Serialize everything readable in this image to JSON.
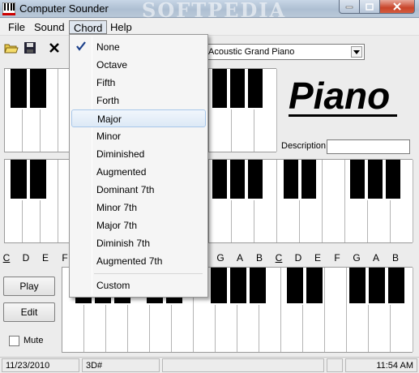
{
  "window": {
    "title": "Computer Sounder",
    "watermark": "SOFTPEDIA",
    "watermark2": "SOFTPEDIA"
  },
  "menubar": {
    "items": [
      {
        "label": "File"
      },
      {
        "label": "Sound"
      },
      {
        "label": "Chord"
      },
      {
        "label": "Help"
      }
    ],
    "active": "Chord"
  },
  "toolbar": {
    "buttons": [
      "open-folder-icon",
      "save-disk-icon",
      "close-x-icon"
    ]
  },
  "instrument": {
    "selected": "Acoustic Grand Piano"
  },
  "instrument_title": "Piano",
  "description": {
    "label": "Description:",
    "value": ""
  },
  "note_labels": [
    "C",
    "D",
    "E",
    "F",
    "G",
    "A",
    "B",
    "C",
    "D",
    "E",
    "F",
    "G",
    "A",
    "B"
  ],
  "buttons": {
    "play": "Play",
    "edit": "Edit"
  },
  "mute": {
    "label": "Mute",
    "checked": false
  },
  "status": {
    "date": "11/23/2010",
    "key": "3D#",
    "blank1": "",
    "blank2": "",
    "time": "11:54 AM"
  },
  "chord_menu": {
    "items": [
      {
        "label": "None",
        "checked": true
      },
      {
        "label": "Octave",
        "checked": false
      },
      {
        "label": "Fifth",
        "checked": false
      },
      {
        "label": "Forth",
        "checked": false
      },
      {
        "label": "Major",
        "checked": false,
        "highlighted": true
      },
      {
        "label": "Minor",
        "checked": false
      },
      {
        "label": "Diminished",
        "checked": false
      },
      {
        "label": "Augmented",
        "checked": false
      },
      {
        "label": "Dominant 7th",
        "checked": false
      },
      {
        "label": "Minor 7th",
        "checked": false
      },
      {
        "label": "Major 7th",
        "checked": false
      },
      {
        "label": "Diminish 7th",
        "checked": false
      },
      {
        "label": "Augmented 7th",
        "checked": false
      },
      {
        "label": "Custom",
        "checked": false
      }
    ]
  },
  "colors": {
    "titlebar": "#b9c8d8",
    "close_button": "#c8442a",
    "highlight": "#dde9f6"
  }
}
